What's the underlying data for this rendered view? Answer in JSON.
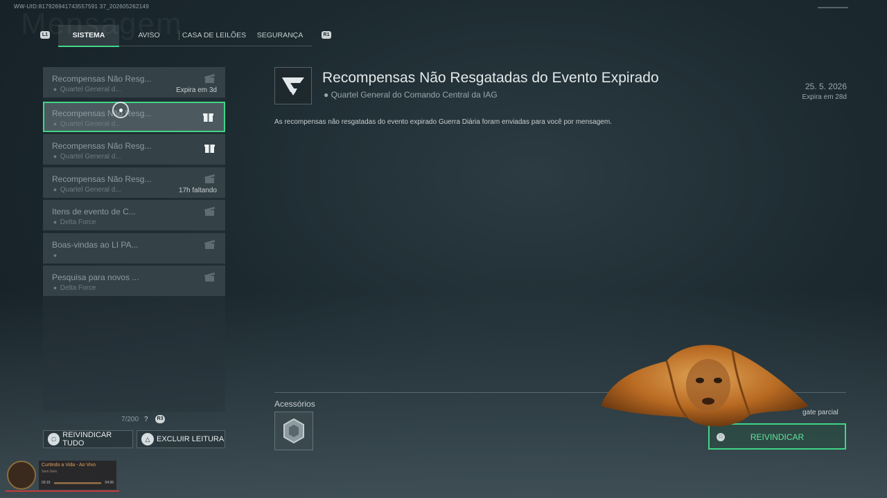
{
  "watermark": "WW-UID:817926941743557591 37_202605262149",
  "background_word": "Mensagem",
  "bumpers": {
    "left": "L1",
    "right": "R1"
  },
  "tabs": [
    {
      "label": "SISTEMA",
      "active": true
    },
    {
      "label": "AVISO",
      "active": false
    },
    {
      "label": "CASA DE LEILÕES",
      "active": false
    },
    {
      "label": "SEGURANÇA",
      "active": false
    }
  ],
  "mail_list": [
    {
      "title": "Recompensas Não Resg...",
      "sender": "Quartel General d...",
      "status": "Expira em 3d",
      "icon": "gift-opened-icon",
      "selected": false
    },
    {
      "title": "Recompensas Não Resg...",
      "sender": "Quartel General d...",
      "status": "",
      "icon": "gift-icon",
      "selected": true
    },
    {
      "title": "Recompensas Não Resg...",
      "sender": "Quartel General d...",
      "status": "",
      "icon": "gift-icon",
      "selected": false
    },
    {
      "title": "Recompensas Não Resg...",
      "sender": "Quartel General d...",
      "status": "17h faltando",
      "icon": "gift-opened-icon",
      "selected": false
    },
    {
      "title": "Itens de evento de C...",
      "sender": "Delta Force",
      "status": "",
      "icon": "gift-opened-icon",
      "selected": false
    },
    {
      "title": "Boas-vindas ao LI PA...",
      "sender": "",
      "status": "",
      "icon": "gift-opened-icon",
      "selected": false
    },
    {
      "title": "Pesquisa para novos ...",
      "sender": "Delta Force",
      "status": "",
      "icon": "gift-opened-icon",
      "selected": false
    }
  ],
  "mail_count": "7/200",
  "mail_count_help": "?",
  "r3_label": "R3",
  "actions": {
    "claim_all": "REIVINDICAR TUDO",
    "claim_all_glyph": "□",
    "delete_read": "EXCLUIR LEITURA",
    "delete_read_glyph": "△"
  },
  "detail": {
    "title": "Recompensas Não Resgatadas do Evento Expirado",
    "sender": "Quartel General do Comando Central da IAG",
    "date": "25. 5. 2026",
    "expires": "Expira em 28d",
    "body": "As recompensas não resgatadas do evento expirado Guerra Diária foram enviadas para você por mensagem.",
    "attachments_label": "Acessórios",
    "partial_claim": "gate parcial",
    "claim_button": "REIVINDICAR",
    "claim_glyph": "□"
  },
  "music_widget": {
    "track": "Curtindo a Vida - Ao Vivo",
    "artist": "Sem Gelo",
    "time_elapsed": "03:15",
    "time_total": "04:36"
  },
  "colors": {
    "accent_green": "#3fd687",
    "background": "#1c2a30",
    "panel": "#46545a"
  }
}
